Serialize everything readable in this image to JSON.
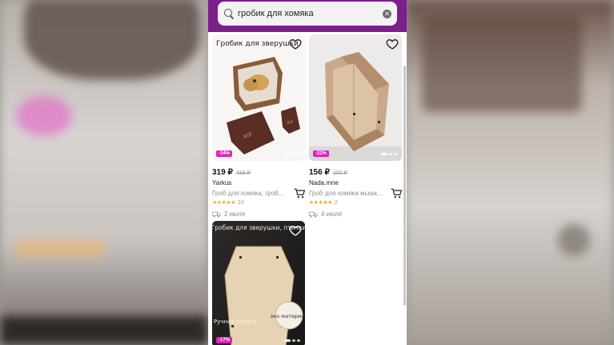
{
  "search": {
    "query": "гробик для хомяка",
    "clear_glyph": "✕"
  },
  "products": [
    {
      "image_text": "Гробик для зверушки",
      "discount": "-34%",
      "price": "319 ₽",
      "old_price": "489 ₽",
      "seller": "Yarkus",
      "description": "Гроб для хомяка, гробик для зверушки",
      "stars": "★★★★★",
      "reviews": "10",
      "delivery": "2 июля"
    },
    {
      "discount": "-22%",
      "price": "156 ₽",
      "old_price": "200 ₽",
      "seller": "Nada.mne",
      "description": "Гроб для хомяка мышки крысы",
      "stars": "★★★★★",
      "reviews": "2",
      "delivery": "4 июля"
    },
    {
      "image_text_top": "Гробик для зверушки, птички",
      "image_text_left": "Ручная работа",
      "image_text_badge": "эко материал",
      "discount": "-17%"
    }
  ],
  "colors": {
    "accent": "#7a1f8c",
    "discount": "#e31dbb",
    "star": "#f5a623"
  }
}
